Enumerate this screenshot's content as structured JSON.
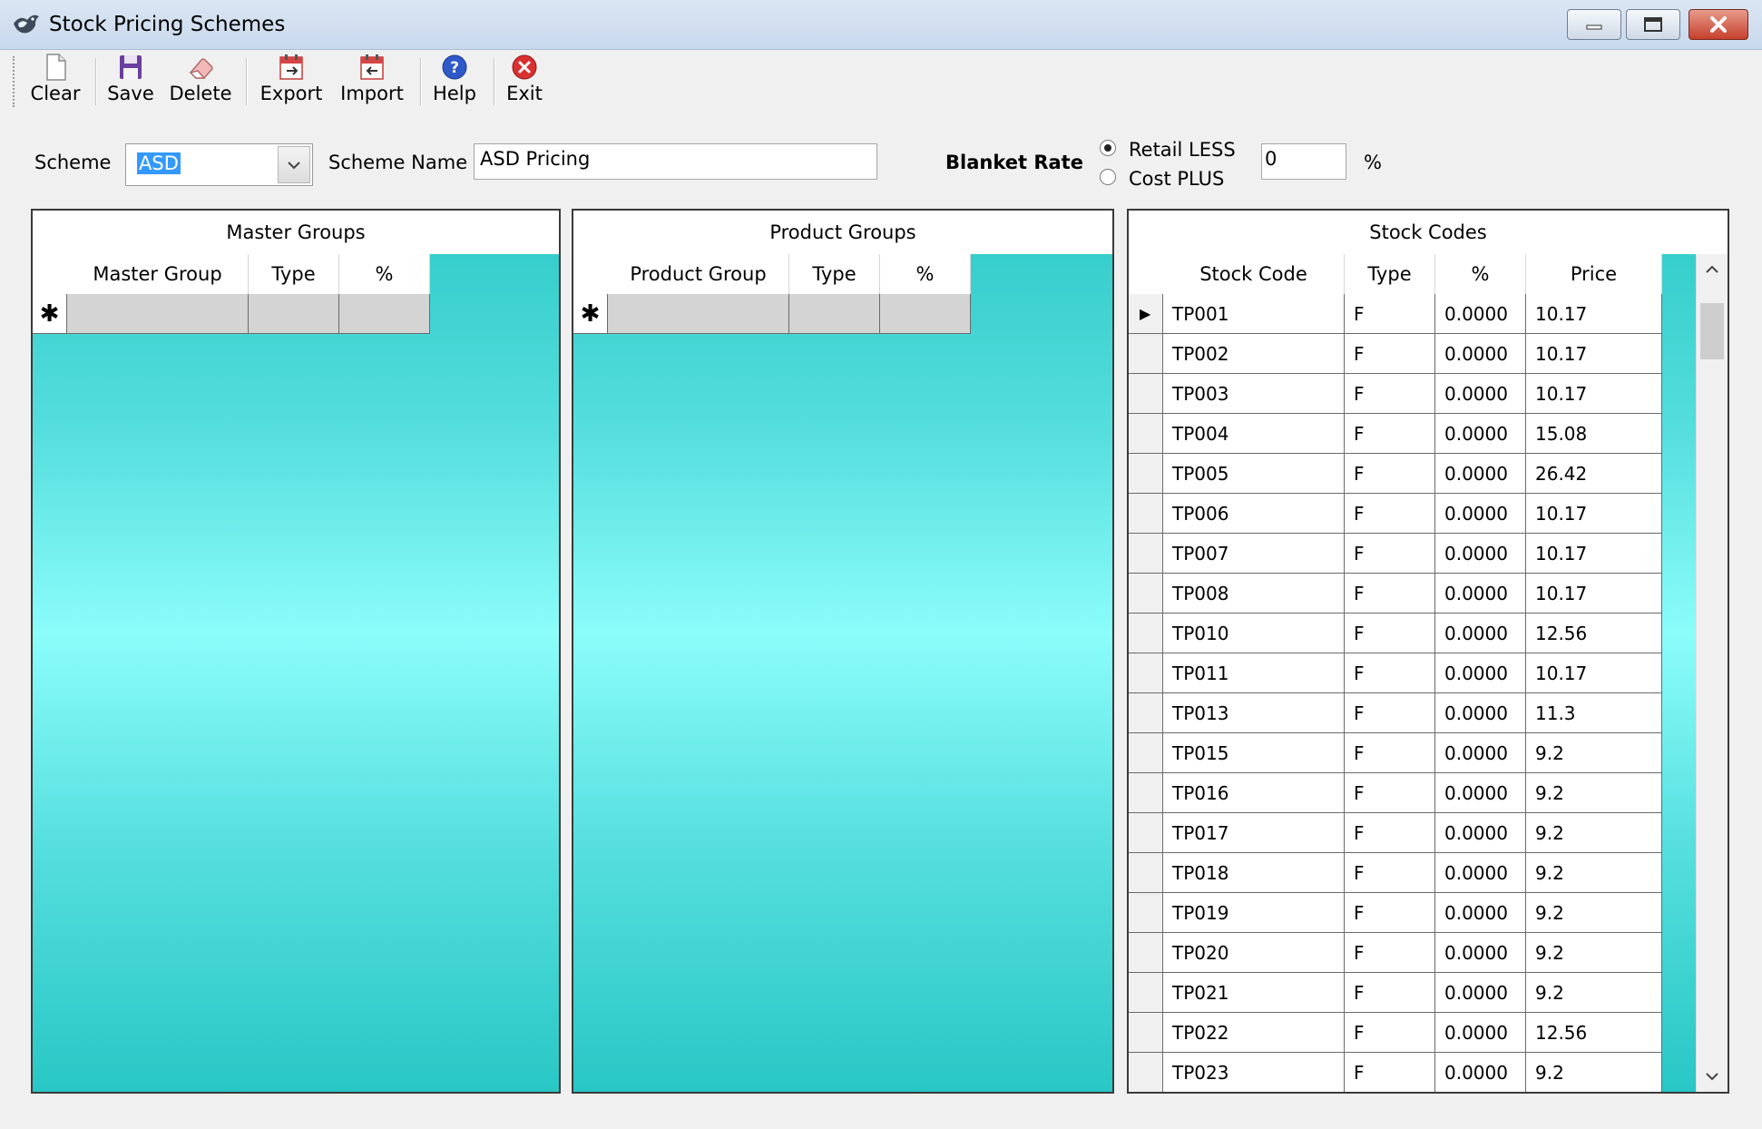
{
  "window": {
    "title": "Stock Pricing Schemes",
    "icon": "app-bird-icon"
  },
  "toolbar": {
    "buttons": [
      {
        "label": "Clear",
        "icon": "new-document-icon"
      },
      {
        "label": "Save",
        "icon": "floppy-disk-icon"
      },
      {
        "label": "Delete",
        "icon": "eraser-icon"
      },
      {
        "label": "Export",
        "icon": "calendar-export-icon"
      },
      {
        "label": "Import",
        "icon": "calendar-import-icon"
      },
      {
        "label": "Help",
        "icon": "help-icon"
      },
      {
        "label": "Exit",
        "icon": "exit-icon"
      }
    ]
  },
  "form": {
    "scheme_label": "Scheme",
    "scheme_value": "ASD",
    "scheme_name_label": "Scheme Name",
    "scheme_name_value": "ASD Pricing",
    "blanket_rate_label": "Blanket Rate",
    "radio_retail": "Retail LESS",
    "radio_cost": "Cost PLUS",
    "selected_option": "Retail LESS",
    "rate_value": "0",
    "percent_sign": "%"
  },
  "master_groups": {
    "caption": "Master Groups",
    "columns": [
      "Master Group",
      "Type",
      "%"
    ],
    "new_row_marker": "✱"
  },
  "product_groups": {
    "caption": "Product Groups",
    "columns": [
      "Product Group",
      "Type",
      "%"
    ],
    "new_row_marker": "✱"
  },
  "stock_codes": {
    "caption": "Stock Codes",
    "columns": [
      "Stock Code",
      "Type",
      "%",
      "Price"
    ],
    "current_row_marker": "▶",
    "rows": [
      {
        "code": "TP001",
        "type": "F",
        "pct": "0.0000",
        "price": "10.17"
      },
      {
        "code": "TP002",
        "type": "F",
        "pct": "0.0000",
        "price": "10.17"
      },
      {
        "code": "TP003",
        "type": "F",
        "pct": "0.0000",
        "price": "10.17"
      },
      {
        "code": "TP004",
        "type": "F",
        "pct": "0.0000",
        "price": "15.08"
      },
      {
        "code": "TP005",
        "type": "F",
        "pct": "0.0000",
        "price": "26.42"
      },
      {
        "code": "TP006",
        "type": "F",
        "pct": "0.0000",
        "price": "10.17"
      },
      {
        "code": "TP007",
        "type": "F",
        "pct": "0.0000",
        "price": "10.17"
      },
      {
        "code": "TP008",
        "type": "F",
        "pct": "0.0000",
        "price": "10.17"
      },
      {
        "code": "TP010",
        "type": "F",
        "pct": "0.0000",
        "price": "12.56"
      },
      {
        "code": "TP011",
        "type": "F",
        "pct": "0.0000",
        "price": "10.17"
      },
      {
        "code": "TP013",
        "type": "F",
        "pct": "0.0000",
        "price": "11.3"
      },
      {
        "code": "TP015",
        "type": "F",
        "pct": "0.0000",
        "price": "9.2"
      },
      {
        "code": "TP016",
        "type": "F",
        "pct": "0.0000",
        "price": "9.2"
      },
      {
        "code": "TP017",
        "type": "F",
        "pct": "0.0000",
        "price": "9.2"
      },
      {
        "code": "TP018",
        "type": "F",
        "pct": "0.0000",
        "price": "9.2"
      },
      {
        "code": "TP019",
        "type": "F",
        "pct": "0.0000",
        "price": "9.2"
      },
      {
        "code": "TP020",
        "type": "F",
        "pct": "0.0000",
        "price": "9.2"
      },
      {
        "code": "TP021",
        "type": "F",
        "pct": "0.0000",
        "price": "9.2"
      },
      {
        "code": "TP022",
        "type": "F",
        "pct": "0.0000",
        "price": "12.56"
      },
      {
        "code": "TP023",
        "type": "F",
        "pct": "0.0000",
        "price": "9.2"
      }
    ]
  },
  "colors": {
    "grid_gradient_edge": "#2ecac8",
    "grid_gradient_center": "#8bfdfb",
    "selection": "#3399ff",
    "close_button": "#c6402b"
  }
}
